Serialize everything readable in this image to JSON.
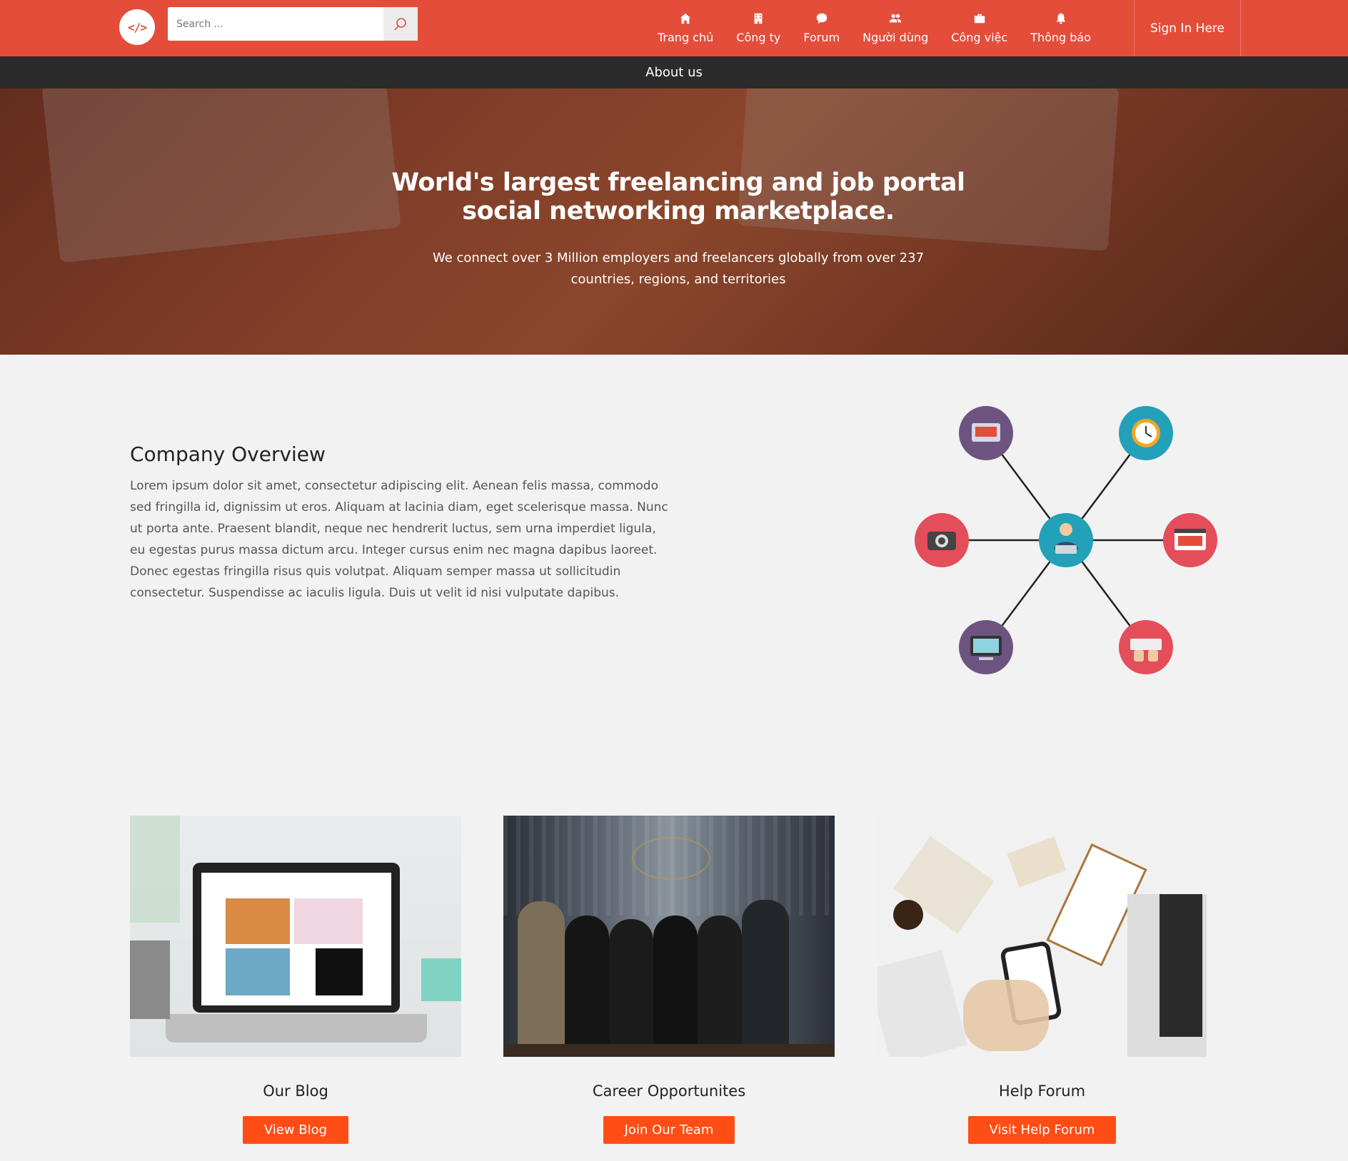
{
  "header": {
    "logo_text": "</>",
    "search_placeholder": "Search ...",
    "nav": [
      {
        "label": "Trang chủ",
        "icon": "home-icon"
      },
      {
        "label": "Công ty",
        "icon": "building-icon"
      },
      {
        "label": "Forum",
        "icon": "chat-icon"
      },
      {
        "label": "Người dùng",
        "icon": "users-icon"
      },
      {
        "label": "Công việc",
        "icon": "briefcase-icon"
      },
      {
        "label": "Thông báo",
        "icon": "bell-icon"
      }
    ],
    "signin_label": "Sign In Here"
  },
  "subbar": {
    "label": "About us"
  },
  "hero": {
    "title_line1": "World's largest freelancing and job portal",
    "title_line2": "social networking marketplace.",
    "subtitle_line1": "We connect over 3 Million employers and freelancers globally from over 237",
    "subtitle_line2": "countries, regions, and territories"
  },
  "overview": {
    "title": "Company Overview",
    "text": "Lorem ipsum dolor sit amet, consectetur adipiscing elit. Aenean felis massa, commodo sed fringilla id, dignissim ut eros. Aliquam at lacinia diam, eget scelerisque massa. Nunc ut porta ante. Praesent blandit, neque nec hendrerit luctus, sem urna imperdiet ligula, eu egestas purus massa dictum arcu. Integer cursus enim nec magna dapibus laoreet. Donec egestas fringilla risus quis volutpat. Aliquam semper massa ut sollicitudin consectetur. Suspendisse ac iaculis ligula. Duis ut velit id nisi vulputate dapibus."
  },
  "cards": [
    {
      "title": "Our Blog",
      "button": "View Blog"
    },
    {
      "title": "Career Opportunites",
      "button": "Join Our Team"
    },
    {
      "title": "Help Forum",
      "button": "Visit Help Forum"
    }
  ],
  "colors": {
    "brand": "#e44d3a",
    "button": "#ff4d15",
    "subbar": "#2b2b2b"
  }
}
